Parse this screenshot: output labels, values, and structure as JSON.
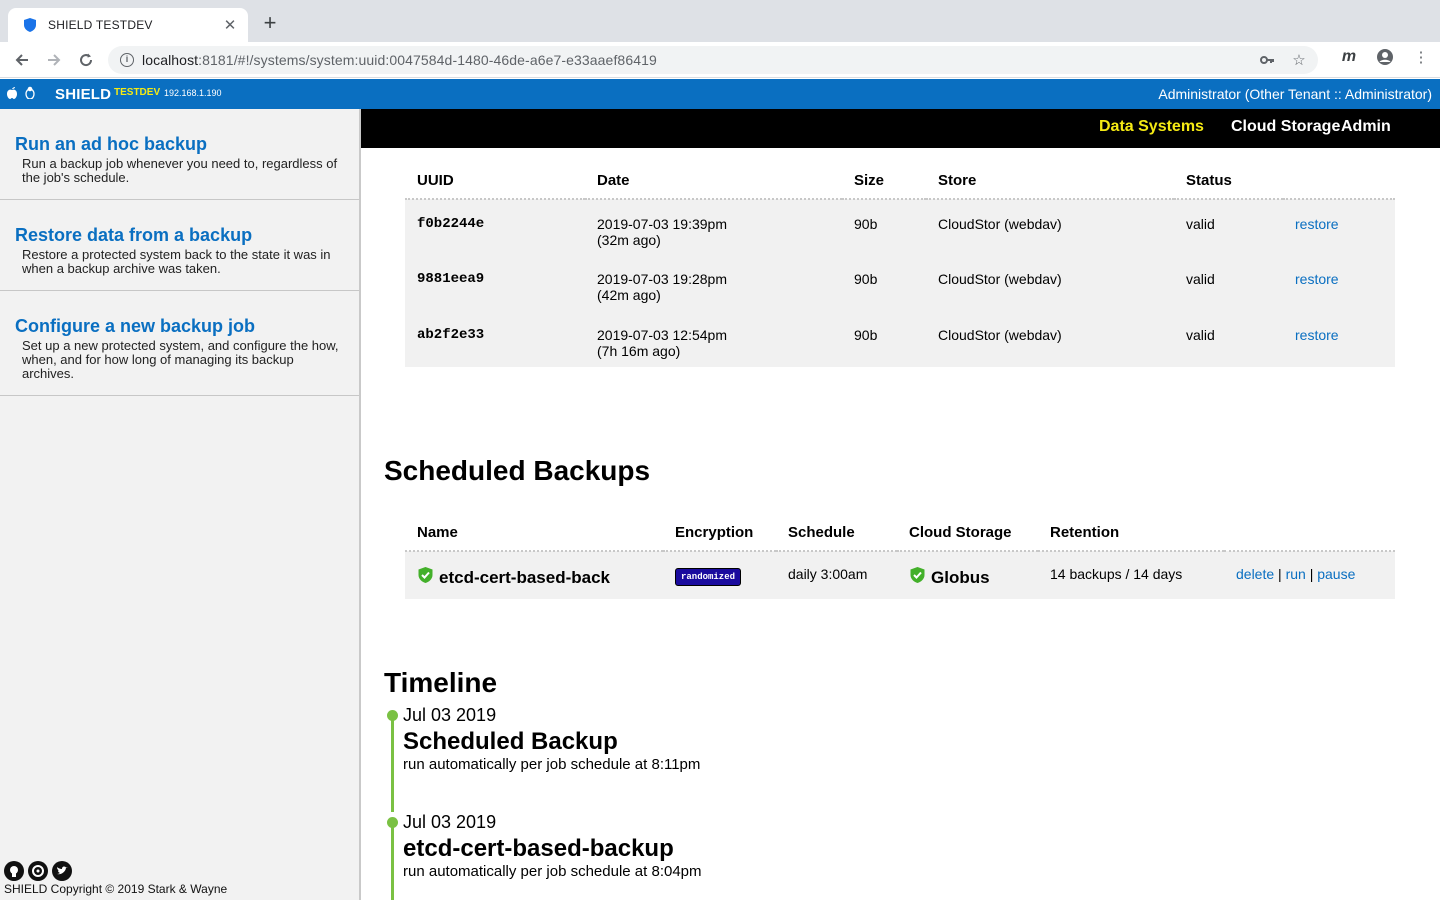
{
  "browser": {
    "tab_title": "SHIELD TESTDEV",
    "url_host": "localhost",
    "url_rest": ":8181/#!/systems/system:uuid:0047584d-1480-46de-a6e7-e33aaef86419",
    "extension_label": "m"
  },
  "header": {
    "brand": "SHIELD",
    "env": "TESTDEV",
    "ip": "192.168.1.190",
    "user": "Administrator (Other Tenant :: Administrator)"
  },
  "nav": {
    "data_systems": "Data Systems",
    "cloud_storage": "Cloud Storage",
    "admin": "Admin"
  },
  "sidebar": {
    "items": [
      {
        "title": "Run an ad hoc backup",
        "desc": "Run a backup job whenever you need to, regardless of the job's schedule."
      },
      {
        "title": "Restore data from a backup",
        "desc": "Restore a protected system back to the state it was in when a backup archive was taken."
      },
      {
        "title": "Configure a new backup job",
        "desc": "Set up a new protected system, and configure the how, when, and for how long of managing its backup archives."
      }
    ],
    "copyright": "SHIELD Copyright © 2019 Stark & Wayne"
  },
  "archives": {
    "columns": [
      "UUID",
      "Date",
      "Size",
      "Store",
      "Status"
    ],
    "rows": [
      {
        "uuid": "f0b2244e",
        "date": "2019-07-03 19:39pm",
        "ago": "(32m ago)",
        "size": "90b",
        "store": "CloudStor (webdav)",
        "status": "valid",
        "action": "restore"
      },
      {
        "uuid": "9881eea9",
        "date": "2019-07-03 19:28pm",
        "ago": "(42m ago)",
        "size": "90b",
        "store": "CloudStor (webdav)",
        "status": "valid",
        "action": "restore"
      },
      {
        "uuid": "ab2f2e33",
        "date": "2019-07-03 12:54pm",
        "ago": "(7h 16m ago)",
        "size": "90b",
        "store": "CloudStor (webdav)",
        "status": "valid",
        "action": "restore"
      }
    ]
  },
  "scheduled": {
    "title": "Scheduled Backups",
    "columns": [
      "Name",
      "Encryption",
      "Schedule",
      "Cloud Storage",
      "Retention"
    ],
    "job": {
      "name": "etcd-cert-based-back",
      "encryption": "randomized",
      "schedule": "daily 3:00am",
      "storage": "Globus",
      "retention": "14 backups / 14 days",
      "delete": "delete",
      "run": "run",
      "pause": "pause",
      "separator": "|"
    }
  },
  "timeline": {
    "title": "Timeline",
    "items": [
      {
        "date": "Jul 03 2019",
        "title": "Scheduled Backup",
        "desc": "run automatically per job schedule at 8:11pm"
      },
      {
        "date": "Jul 03 2019",
        "title": "etcd-cert-based-backup",
        "desc": "run automatically per job schedule at 8:04pm"
      }
    ]
  },
  "colors": {
    "brand_blue": "#0a6fc1",
    "active_nav": "#f5ea14",
    "timeline_green": "#7ac143",
    "badge_navy": "#1a0b9e"
  }
}
